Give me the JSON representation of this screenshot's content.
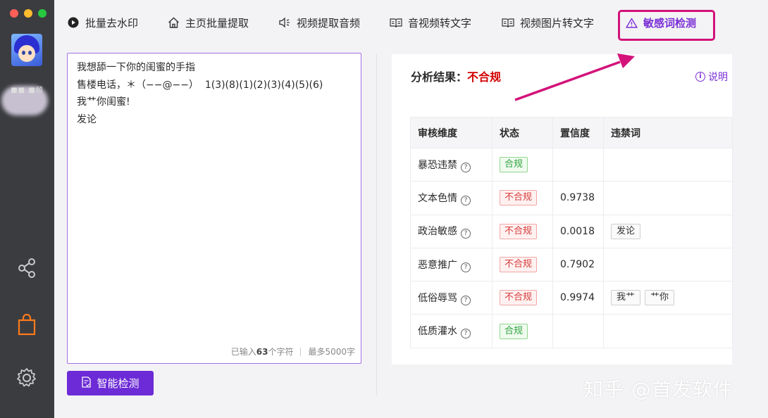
{
  "sidebar": {
    "user_name": "■■ ■频"
  },
  "nav": {
    "items": [
      {
        "label": "批量去水印",
        "icon": "play-circle-icon"
      },
      {
        "label": "主页批量提取",
        "icon": "home-icon"
      },
      {
        "label": "视频提取音频",
        "icon": "speaker-icon"
      },
      {
        "label": "音视频转文字",
        "icon": "book-icon"
      },
      {
        "label": "视频图片转文字",
        "icon": "book-icon"
      },
      {
        "label": "敏感词检测",
        "icon": "warning-triangle-icon"
      }
    ],
    "active_index": 5
  },
  "editor": {
    "content": "我想舔一下你的闺蜜的手指\n售楼电话，＊（−−@−−）  1(3)(8)(1)(2)(3)(4)(5)(6)\n我艹你闺蜜!\n发论",
    "counter_prefix": "已输入",
    "counter_count": "63",
    "counter_suffix": "个字符",
    "counter_max": "最多5000字"
  },
  "detect_button": {
    "label": "智能检测"
  },
  "result": {
    "title_label": "分析结果：",
    "title_value": "不合规",
    "help_label": "说明",
    "columns": [
      "审核维度",
      "状态",
      "置信度",
      "违禁词"
    ],
    "rows": [
      {
        "dimension": "暴恐违禁",
        "status": "合规",
        "ok": true,
        "confidence": "",
        "words": []
      },
      {
        "dimension": "文本色情",
        "status": "不合规",
        "ok": false,
        "confidence": "0.9738",
        "words": []
      },
      {
        "dimension": "政治敏感",
        "status": "不合规",
        "ok": false,
        "confidence": "0.0018",
        "words": [
          "发论"
        ]
      },
      {
        "dimension": "恶意推广",
        "status": "不合规",
        "ok": false,
        "confidence": "0.7902",
        "words": []
      },
      {
        "dimension": "低俗辱骂",
        "status": "不合规",
        "ok": false,
        "confidence": "0.9974",
        "words": [
          "我艹",
          "艹你"
        ]
      },
      {
        "dimension": "低质灌水",
        "status": "合规",
        "ok": true,
        "confidence": "",
        "words": []
      }
    ]
  },
  "watermark": "知乎 @首发软件",
  "colors": {
    "accent": "#6c2bd6",
    "highlight": "#d3127a",
    "danger": "#d10000",
    "ok": "#2ea23f"
  }
}
